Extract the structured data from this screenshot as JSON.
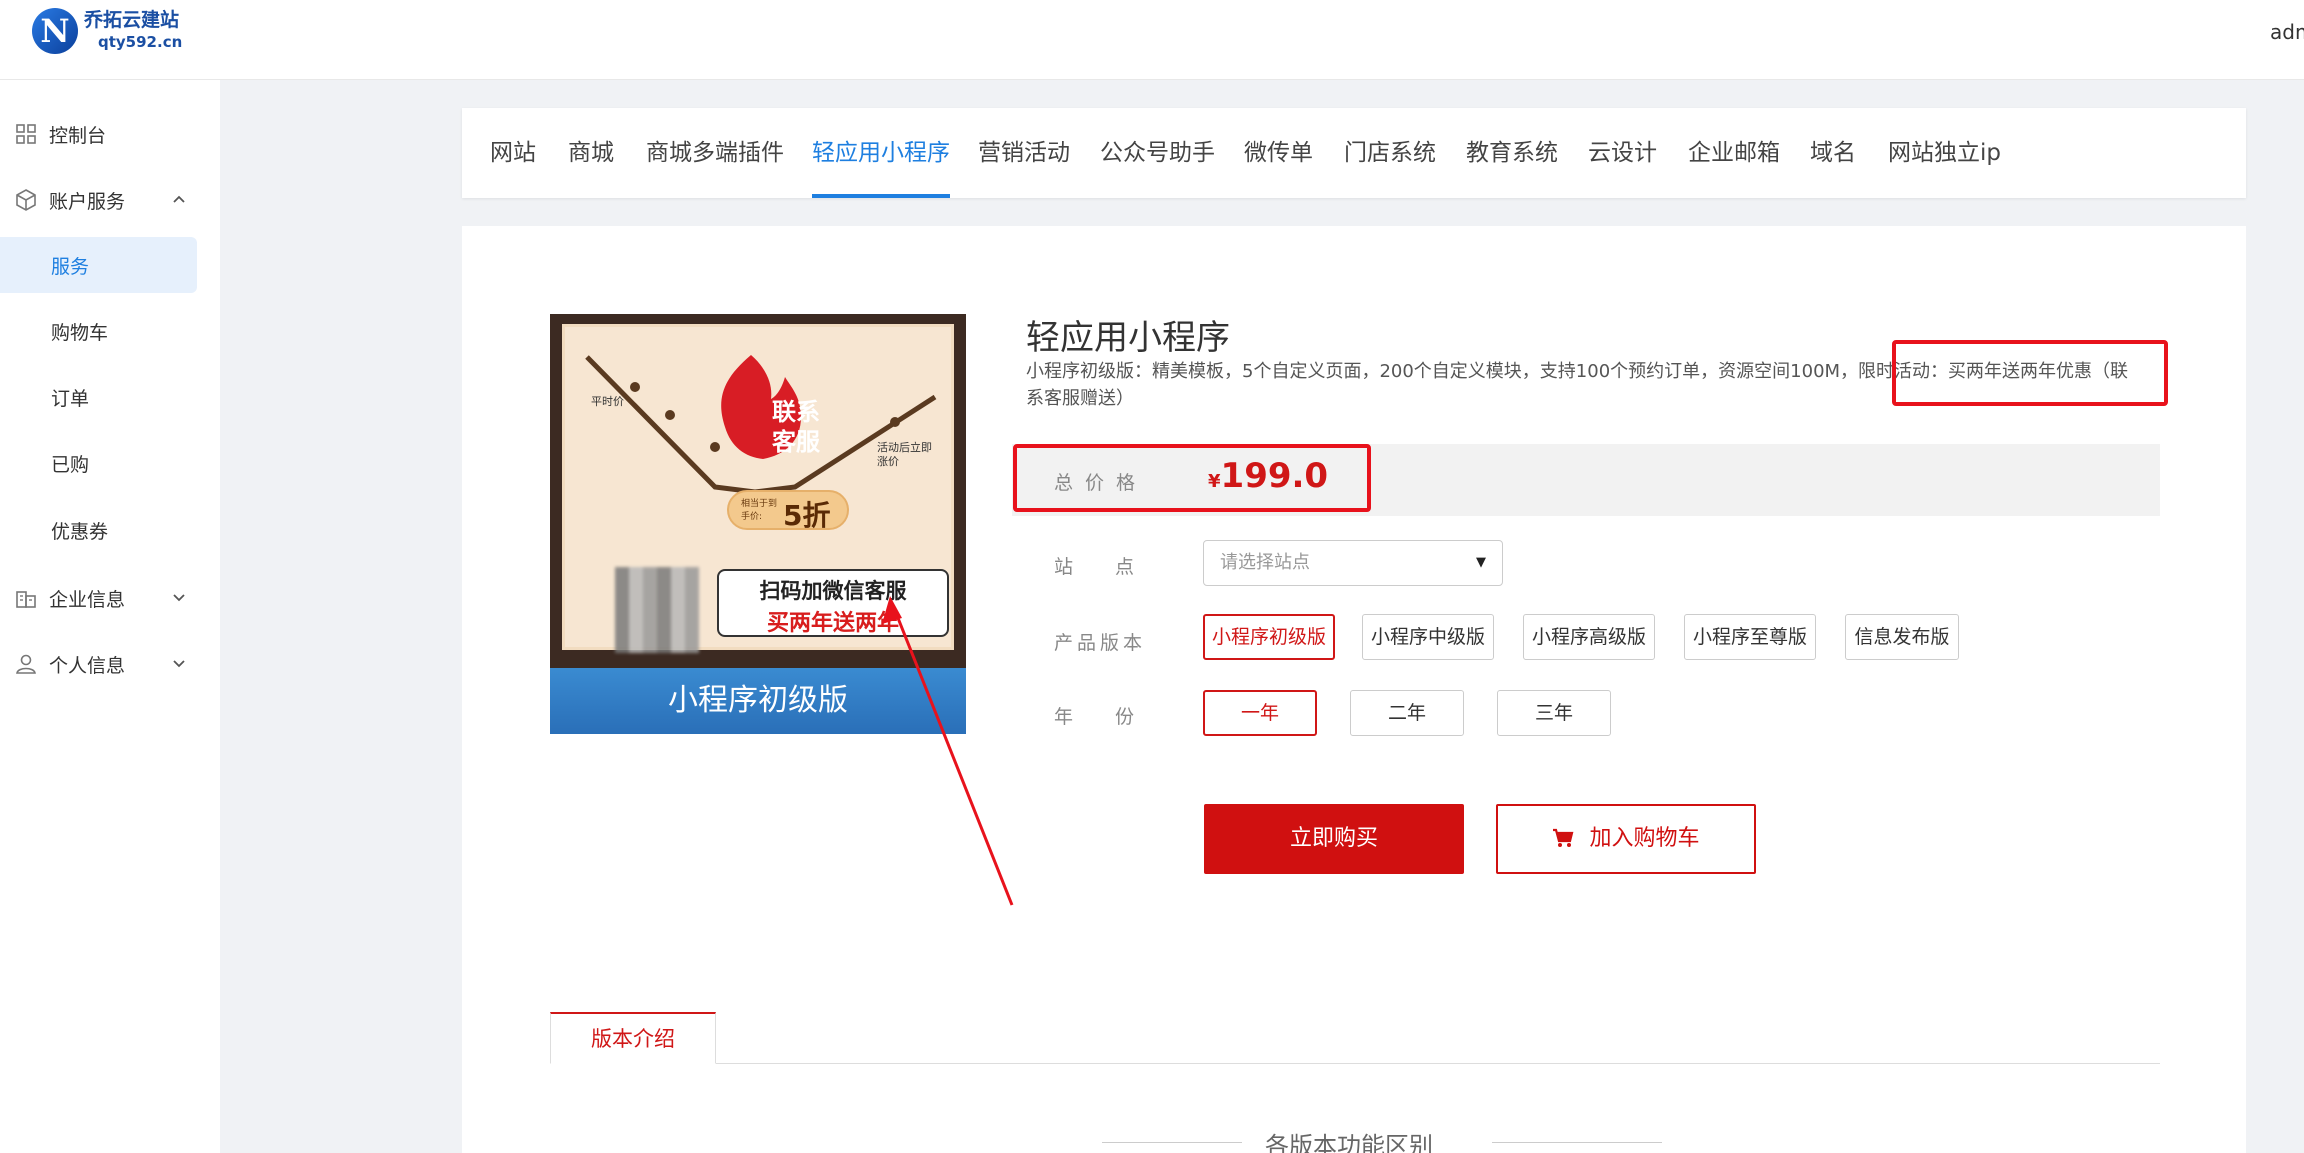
{
  "header": {
    "logo_name": "乔拓云建站",
    "logo_domain": "qty592.cn",
    "user": "adm"
  },
  "sidebar": {
    "items": [
      {
        "label": "控制台",
        "icon": "grid-icon"
      },
      {
        "label": "账户服务",
        "icon": "cube-icon",
        "expanded": true
      },
      {
        "label": "服务",
        "active": true
      },
      {
        "label": "购物车"
      },
      {
        "label": "订单"
      },
      {
        "label": "已购"
      },
      {
        "label": "优惠券"
      },
      {
        "label": "企业信息",
        "icon": "building-icon"
      },
      {
        "label": "个人信息",
        "icon": "user-icon"
      }
    ]
  },
  "tabs": [
    "网站",
    "商城",
    "商城多端插件",
    "轻应用小程序",
    "营销活动",
    "公众号助手",
    "微传单",
    "门店系统",
    "教育系统",
    "云设计",
    "企业邮箱",
    "域名",
    "网站独立ip"
  ],
  "active_tab": "轻应用小程序",
  "product": {
    "title": "轻应用小程序",
    "description": "小程序初级版：精美模板，5个自定义页面，200个自定义模块，支持100个预约订单，资源空间100M，限时活动：买两年送两年优惠（联系客服赠送）",
    "image": {
      "banner": "小程序初级版",
      "flame_text": "联系客服",
      "label_normal": "平时价",
      "label_after": "活动后立即涨价",
      "discount_small": "相当于到手价:",
      "discount_big": "5折",
      "bubble_line1": "扫码加微信客服",
      "bubble_line2": "买两年送两年"
    },
    "price_label": "总价格",
    "price_symbol": "¥",
    "price_value": "199.0",
    "site_label": "站点",
    "site_placeholder": "请选择站点",
    "version_label": "产品版本",
    "versions": [
      "小程序初级版",
      "小程序中级版",
      "小程序高级版",
      "小程序至尊版",
      "信息发布版"
    ],
    "selected_version": "小程序初级版",
    "year_label": "年份",
    "years": [
      "一年",
      "二年",
      "三年"
    ],
    "selected_year": "一年",
    "buy_label": "立即购买",
    "cart_label": "加入购物车"
  },
  "intro": {
    "tab_label": "版本介绍",
    "section_title": "各版本功能区别"
  },
  "colors": {
    "accent": "#1e7fe0",
    "price_red": "#d01717",
    "annotation_red": "#e8121c"
  }
}
